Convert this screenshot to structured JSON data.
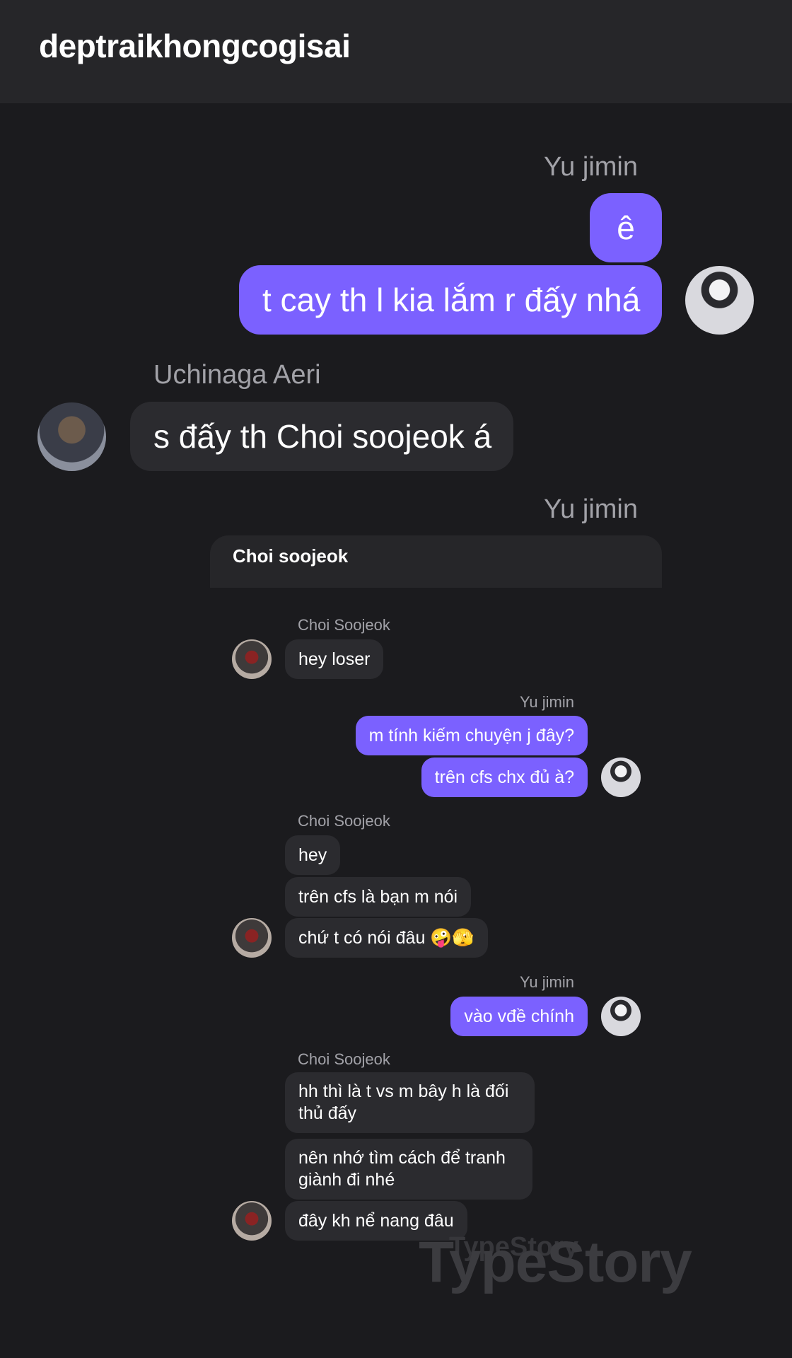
{
  "header": {
    "title": "deptraikhongcogisai"
  },
  "messages": {
    "jimin_name_1": "Yu jimin",
    "jimin_msg_1": "ê",
    "jimin_msg_2": "t cay th l kia lắm r đấy nhá",
    "aeri_name": "Uchinaga Aeri",
    "aeri_msg_1": "s đấy th Choi soojeok á",
    "jimin_name_2": "Yu jimin"
  },
  "shared_chat": {
    "title": "Choi soojeok",
    "soo_name_1": "Choi Soojeok",
    "soo_msg_1": "hey loser",
    "jimin_name_1": "Yu jimin",
    "jimin_msg_1": "m tính kiếm chuyện j đây?",
    "jimin_msg_2": "trên cfs chx đủ à?",
    "soo_name_2": "Choi Soojeok",
    "soo_msg_2": "hey",
    "soo_msg_3": "trên cfs là bạn m nói",
    "soo_msg_4": "chứ t có nói đâu 🤪🫣",
    "jimin_name_2": "Yu jimin",
    "jimin_msg_3": "vào vđề chính",
    "soo_name_3": "Choi Soojeok",
    "soo_msg_5": "hh thì là t vs m bây h là đối thủ đấy",
    "soo_msg_6": "nên nhớ tìm cách để tranh giành đi nhé",
    "soo_msg_7": "đây kh nể nang đâu"
  },
  "watermark": {
    "text": "TypeStory",
    "text_small": "TypeStory"
  },
  "colors": {
    "accent": "#7b61ff",
    "background": "#1b1b1e",
    "bubble_gray": "#2b2b2f"
  }
}
